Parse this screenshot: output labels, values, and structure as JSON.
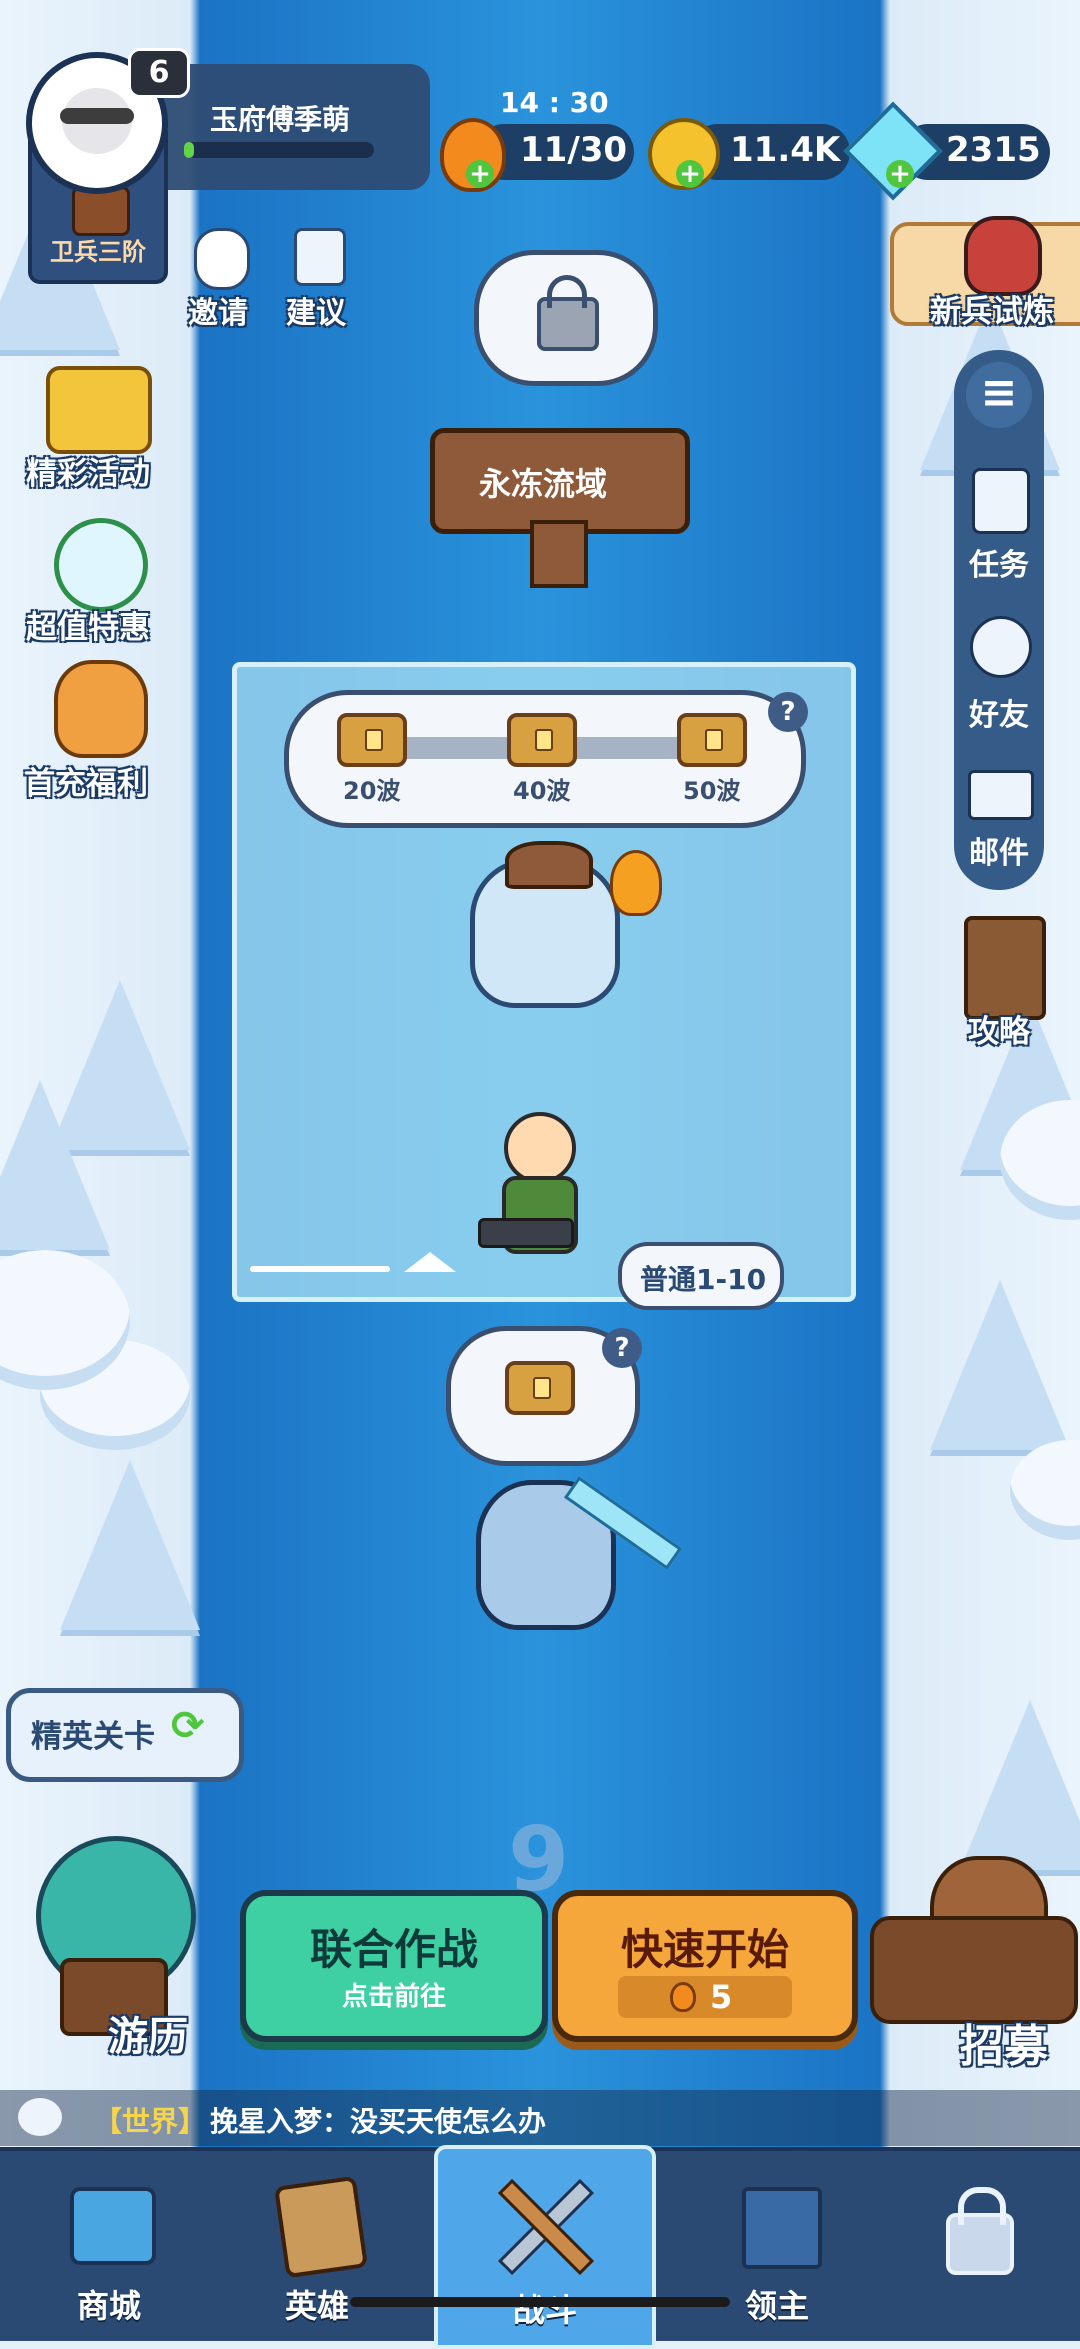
{
  "player": {
    "level": "6",
    "name": "玉府傅季萌",
    "rank": "卫兵三阶"
  },
  "resources": {
    "timer": "14 : 30",
    "stamina": "11/30",
    "gold": "11.4K",
    "gems": "2315"
  },
  "left_buttons": {
    "invite": "邀请",
    "suggest": "建议",
    "events": "精彩活动",
    "deals": "超值特惠",
    "first_recharge": "首充福利",
    "elite": "精英关卡",
    "travel": "游历"
  },
  "right_buttons": {
    "trial": "新兵试炼",
    "tasks": "任务",
    "friends": "好友",
    "mail": "邮件",
    "guide": "攻略",
    "recruit": "招募"
  },
  "map": {
    "zone_sign": "永冻流域",
    "rewards": [
      "20波",
      "40波",
      "50波"
    ],
    "stage_label": "普通1-10",
    "next_stage": "9"
  },
  "actions": {
    "coop_title": "联合作战",
    "coop_sub": "点击前往",
    "quick_title": "快速开始",
    "quick_cost": "5"
  },
  "chat": {
    "channel": "【世界】",
    "message": "挽星入梦：没买天使怎么办"
  },
  "nav": {
    "shop": "商城",
    "heroes": "英雄",
    "battle": "战斗",
    "lord": "领主"
  },
  "colors": {
    "coop_green": "#3ecfa3",
    "quick_orange": "#f5a73b",
    "river_blue": "#2a93dc",
    "nav_bg": "#2a4a74"
  }
}
